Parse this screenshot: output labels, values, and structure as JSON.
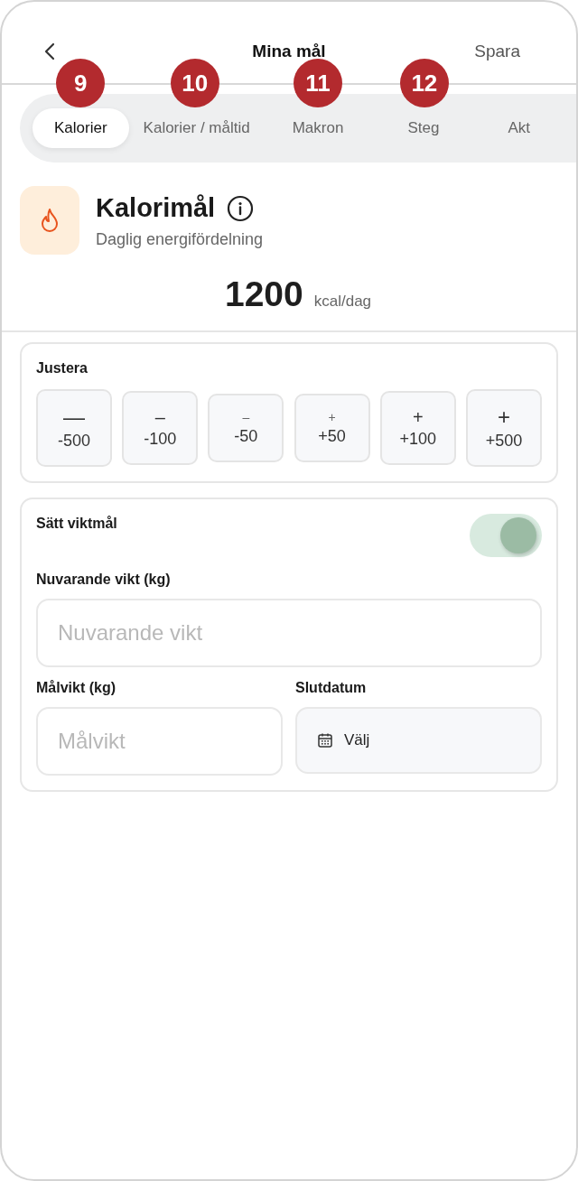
{
  "header": {
    "title": "Mina mål",
    "action": "Spara"
  },
  "tabs": [
    {
      "label": "Kalorier",
      "selected": true,
      "badge": "9"
    },
    {
      "label": "Kalorier / måltid",
      "selected": false,
      "badge": "10"
    },
    {
      "label": "Makron",
      "selected": false,
      "badge": "11"
    },
    {
      "label": "Steg",
      "selected": false,
      "badge": "12"
    },
    {
      "label": "Akt",
      "selected": false
    }
  ],
  "goal": {
    "title": "Kalorimål",
    "subtitle": "Daglig energifördelning",
    "value": "1200",
    "unit": "kcal/dag"
  },
  "adjust": {
    "title": "Justera",
    "buttons": [
      {
        "sign": "—",
        "label": "-500",
        "kind": "large"
      },
      {
        "sign": "–",
        "label": "-100",
        "kind": "medium"
      },
      {
        "sign": "–",
        "label": "-50",
        "kind": "small"
      },
      {
        "sign": "+",
        "label": "+50",
        "kind": "small"
      },
      {
        "sign": "+",
        "label": "+100",
        "kind": "medium"
      },
      {
        "sign": "+",
        "label": "+500",
        "kind": "large"
      }
    ]
  },
  "weight_goal": {
    "title": "Sätt viktmål",
    "on": true,
    "current_label": "Nuvarande vikt (kg)",
    "current_placeholder": "Nuvarande vikt",
    "target_label": "Målvikt (kg)",
    "target_placeholder": "Målvikt",
    "date_label": "Slutdatum",
    "date_button": "Välj"
  }
}
